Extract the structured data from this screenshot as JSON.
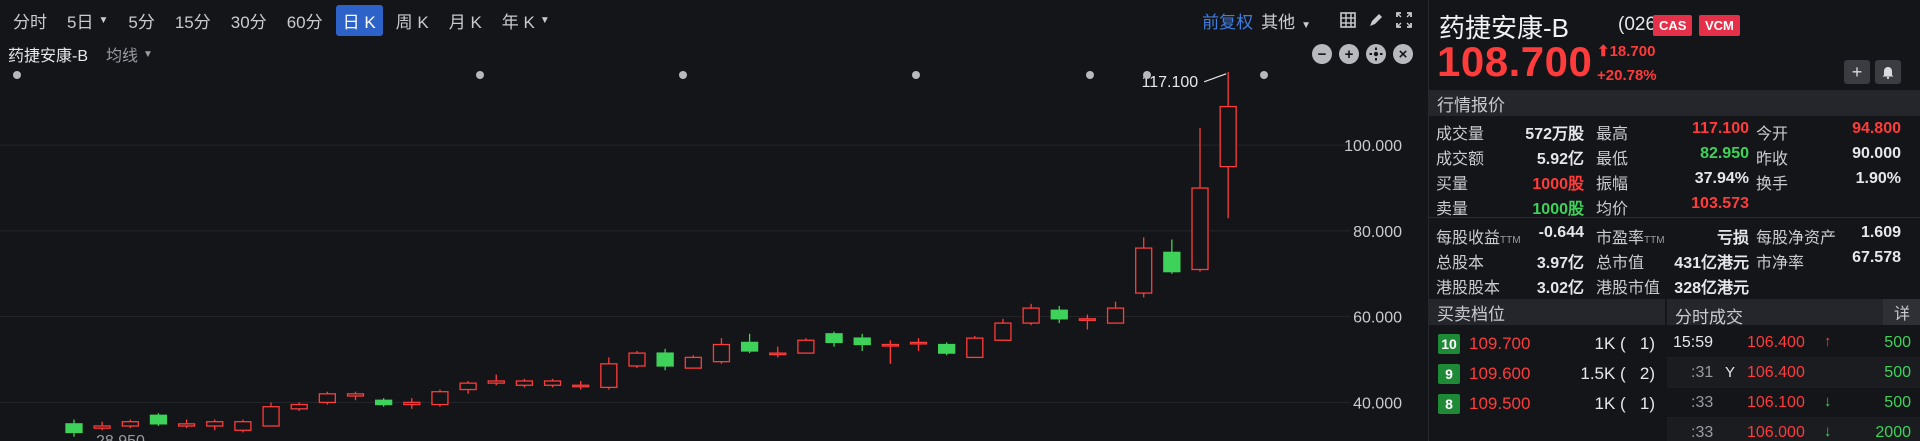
{
  "toolbar": {
    "timeframes": [
      "分时",
      "5日",
      "5分",
      "15分",
      "30分",
      "60分",
      "日 K",
      "周 K",
      "月 K",
      "年 K"
    ],
    "adjust_label": "前复权",
    "more_label": "其他"
  },
  "legend": {
    "stock_name": "药捷安康-B",
    "ma_label": "均线"
  },
  "chart_data": {
    "type": "candlestick",
    "y_ticks": [
      "100.000",
      "80.000",
      "60.000",
      "40.000"
    ],
    "ylim": [
      31,
      118
    ],
    "max_label": "117.100",
    "min_label_partial": "28.950",
    "candles": [
      {
        "o": 35.0,
        "c": 33.0,
        "h": 36.0,
        "l": 32.0
      },
      {
        "o": 34.0,
        "c": 34.5,
        "h": 35.5,
        "l": 33.5
      },
      {
        "o": 34.5,
        "c": 35.5,
        "h": 36.0,
        "l": 34.0
      },
      {
        "o": 37.0,
        "c": 35.0,
        "h": 37.5,
        "l": 34.5
      },
      {
        "o": 34.5,
        "c": 35.0,
        "h": 36.0,
        "l": 34.0
      },
      {
        "o": 34.5,
        "c": 35.5,
        "h": 36.0,
        "l": 33.5
      },
      {
        "o": 33.5,
        "c": 35.5,
        "h": 36.0,
        "l": 33.0
      },
      {
        "o": 34.5,
        "c": 39.0,
        "h": 40.0,
        "l": 34.5
      },
      {
        "o": 38.5,
        "c": 39.5,
        "h": 40.0,
        "l": 38.0
      },
      {
        "o": 40.0,
        "c": 42.0,
        "h": 42.5,
        "l": 39.5
      },
      {
        "o": 41.5,
        "c": 42.0,
        "h": 42.5,
        "l": 40.5
      },
      {
        "o": 40.5,
        "c": 39.5,
        "h": 41.0,
        "l": 39.0
      },
      {
        "o": 39.5,
        "c": 40.0,
        "h": 41.0,
        "l": 38.5
      },
      {
        "o": 39.5,
        "c": 42.5,
        "h": 43.0,
        "l": 39.0
      },
      {
        "o": 43.0,
        "c": 44.5,
        "h": 45.0,
        "l": 42.0
      },
      {
        "o": 44.5,
        "c": 45.0,
        "h": 46.5,
        "l": 44.0
      },
      {
        "o": 44.0,
        "c": 45.0,
        "h": 45.5,
        "l": 43.5
      },
      {
        "o": 44.0,
        "c": 45.0,
        "h": 45.5,
        "l": 43.5
      },
      {
        "o": 44.0,
        "c": 44.0,
        "h": 45.0,
        "l": 43.0
      },
      {
        "o": 43.5,
        "c": 49.0,
        "h": 50.5,
        "l": 43.0
      },
      {
        "o": 48.5,
        "c": 51.5,
        "h": 52.0,
        "l": 48.0
      },
      {
        "o": 51.5,
        "c": 48.5,
        "h": 52.5,
        "l": 47.5
      },
      {
        "o": 48.0,
        "c": 50.5,
        "h": 51.0,
        "l": 48.0
      },
      {
        "o": 49.5,
        "c": 53.5,
        "h": 55.0,
        "l": 49.0
      },
      {
        "o": 54.0,
        "c": 52.0,
        "h": 56.0,
        "l": 51.5
      },
      {
        "o": 51.5,
        "c": 51.5,
        "h": 53.0,
        "l": 50.5
      },
      {
        "o": 51.5,
        "c": 54.5,
        "h": 55.0,
        "l": 51.5
      },
      {
        "o": 56.0,
        "c": 54.0,
        "h": 56.5,
        "l": 53.0
      },
      {
        "o": 55.0,
        "c": 53.5,
        "h": 56.0,
        "l": 52.0
      },
      {
        "o": 53.5,
        "c": 53.5,
        "h": 54.5,
        "l": 49.0
      },
      {
        "o": 54.0,
        "c": 54.0,
        "h": 55.0,
        "l": 52.0
      },
      {
        "o": 53.5,
        "c": 51.5,
        "h": 54.0,
        "l": 51.0
      },
      {
        "o": 50.5,
        "c": 55.0,
        "h": 55.5,
        "l": 50.5
      },
      {
        "o": 54.5,
        "c": 58.5,
        "h": 59.5,
        "l": 54.5
      },
      {
        "o": 58.5,
        "c": 62.0,
        "h": 63.0,
        "l": 58.0
      },
      {
        "o": 61.5,
        "c": 59.5,
        "h": 62.5,
        "l": 58.5
      },
      {
        "o": 59.5,
        "c": 59.5,
        "h": 60.5,
        "l": 57.0
      },
      {
        "o": 58.5,
        "c": 62.0,
        "h": 63.5,
        "l": 58.5
      },
      {
        "o": 65.5,
        "c": 76.0,
        "h": 78.5,
        "l": 64.5
      },
      {
        "o": 75.0,
        "c": 70.5,
        "h": 78.0,
        "l": 70.0
      },
      {
        "o": 71.0,
        "c": 90.0,
        "h": 104.0,
        "l": 70.5
      },
      {
        "o": 95.0,
        "c": 109.0,
        "h": 117.1,
        "l": 82.95
      }
    ]
  },
  "quote": {
    "name": "药捷安康-B",
    "code": "(02617)",
    "badges": [
      "CAS",
      "VCM"
    ],
    "price": "108.700",
    "change": "18.700",
    "change_pct": "+20.78%",
    "section_title": "行情报价",
    "rows": [
      [
        {
          "l": "成交量",
          "v": "572万股",
          "c": "white"
        },
        {
          "l": "最高",
          "v": "117.100",
          "c": "red"
        },
        {
          "l": "今开",
          "v": "94.800",
          "c": "red"
        }
      ],
      [
        {
          "l": "成交额",
          "v": "5.92亿",
          "c": "white"
        },
        {
          "l": "最低",
          "v": "82.950",
          "c": "green"
        },
        {
          "l": "昨收",
          "v": "90.000",
          "c": "white"
        }
      ],
      [
        {
          "l": "买量",
          "v": "1000股",
          "c": "red"
        },
        {
          "l": "振幅",
          "v": "37.94%",
          "c": "white"
        },
        {
          "l": "换手",
          "v": "1.90%",
          "c": "white"
        }
      ],
      [
        {
          "l": "卖量",
          "v": "1000股",
          "c": "green"
        },
        {
          "l": "均价",
          "v": "103.573",
          "c": "red"
        },
        {
          "l": "",
          "v": "",
          "c": "white"
        }
      ],
      [
        {
          "l": "每股收益",
          "ttm": "TTM",
          "v": "-0.644",
          "c": "white"
        },
        {
          "l": "市盈率",
          "ttm": "TTM",
          "v": "亏损",
          "c": "white"
        },
        {
          "l": "每股净资产",
          "v": "1.609",
          "c": "white"
        }
      ],
      [
        {
          "l": "总股本",
          "v": "3.97亿",
          "c": "white"
        },
        {
          "l": "总市值",
          "v": "431亿港元",
          "c": "white"
        },
        {
          "l": "市净率",
          "v": "67.578",
          "c": "white"
        }
      ],
      [
        {
          "l": "港股股本",
          "v": "3.02亿",
          "c": "white"
        },
        {
          "l": "港股市值",
          "v": "328亿港元",
          "c": "white"
        },
        {
          "l": "",
          "v": "",
          "c": "white"
        }
      ]
    ]
  },
  "order_book": {
    "title": "买卖档位",
    "levels": [
      {
        "level": "10",
        "price": "109.700",
        "vol": "1K (",
        "count": "1)"
      },
      {
        "level": "9",
        "price": "109.600",
        "vol": "1.5K (",
        "count": "2)"
      },
      {
        "level": "8",
        "price": "109.500",
        "vol": "1K (",
        "count": "1)"
      }
    ]
  },
  "ticks": {
    "title": "分时成交",
    "detail_label": "详",
    "rows": [
      {
        "time": "15:59",
        "flag": "",
        "price": "106.400",
        "arrow": "↑",
        "vol": "500"
      },
      {
        "time": ":31",
        "flag": "Y",
        "price": "106.400",
        "arrow": "",
        "vol": "500"
      },
      {
        "time": ":33",
        "flag": "",
        "price": "106.100",
        "arrow": "↓",
        "vol": "500"
      },
      {
        "time": ":33",
        "flag": "",
        "price": "106.000",
        "arrow": "↓",
        "vol": "2000"
      }
    ]
  },
  "colors": {
    "up": "#ff3b3b",
    "down": "#3fd25a",
    "accent": "#2d63c8"
  }
}
